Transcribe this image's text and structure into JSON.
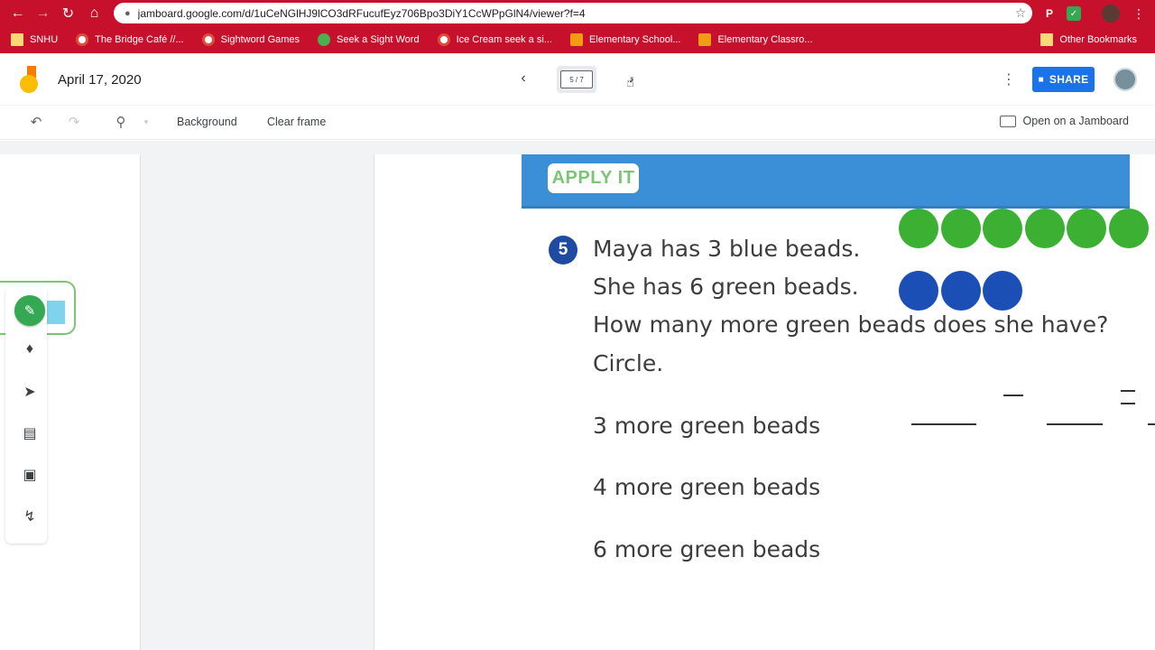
{
  "browser": {
    "url": "jamboard.google.com/d/1uCeNGlHJ9lCO3dRFucufEyz706Bpo3DiY1CcWPpGlN4/viewer?f=4",
    "accent": "#c7112c",
    "bookmarks": [
      {
        "label": "SNHU",
        "icon": "folder-icon"
      },
      {
        "label": "The Bridge Café //...",
        "icon": "chrome-icon"
      },
      {
        "label": "Sightword Games",
        "icon": "chrome-icon"
      },
      {
        "label": "Seek a Sight Word",
        "icon": "green-icon"
      },
      {
        "label": "Ice Cream seek a si...",
        "icon": "chrome-icon"
      },
      {
        "label": "Elementary School...",
        "icon": "orange-icon"
      },
      {
        "label": "Elementary Classro...",
        "icon": "orange-icon"
      }
    ],
    "other_bookmarks": "Other Bookmarks"
  },
  "header": {
    "title": "April 17, 2020",
    "frame_indicator": "5 / 7",
    "share_label": "SHARE"
  },
  "toolbar": {
    "background_label": "Background",
    "clear_frame_label": "Clear frame",
    "open_on_jamboard_label": "Open on a Jamboard"
  },
  "worksheet": {
    "banner": "APPLY IT",
    "question_number": "5",
    "lines": [
      "Maya has 3 blue beads.",
      "She has 6 green beads.",
      "How many more green beads does she have?",
      "Circle."
    ],
    "choices": [
      "3 more green beads",
      "4 more green beads",
      "6 more green beads"
    ],
    "green_beads": 6,
    "blue_beads": 3,
    "colors": {
      "banner": "#3b8fd6",
      "green_bead": "#3bb033",
      "blue_bead": "#1b4fb6",
      "number_badge": "#1f4aa1"
    }
  }
}
